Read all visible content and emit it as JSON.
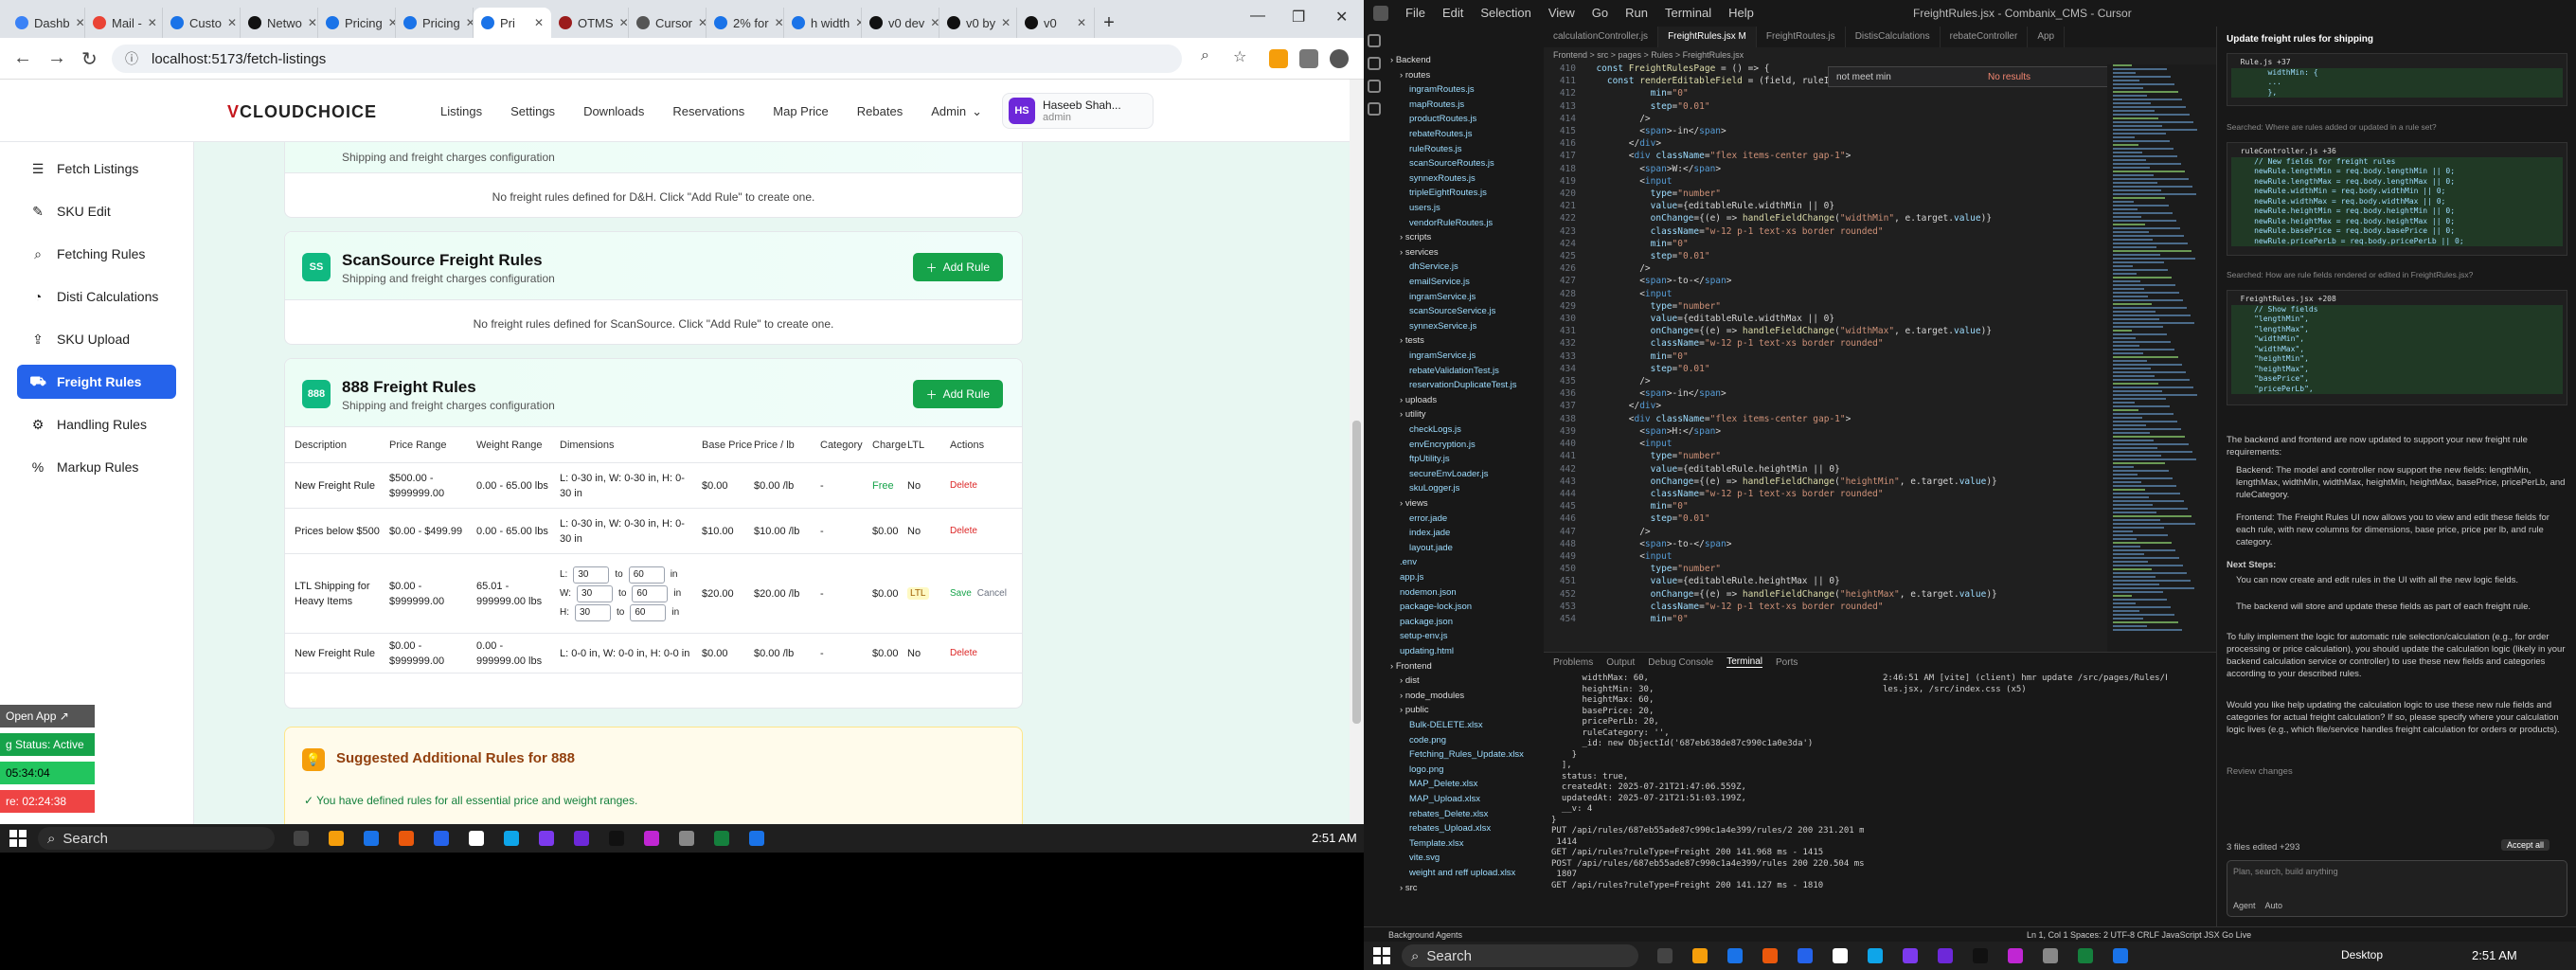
{
  "browser": {
    "tabs": [
      {
        "label": "Dashb",
        "color": "#3b82f6"
      },
      {
        "label": "Mail -",
        "color": "#ea4335"
      },
      {
        "label": "Custo",
        "color": "#1a73e8"
      },
      {
        "label": "Netwo",
        "color": "#111111"
      },
      {
        "label": "Pricing",
        "color": "#1a73e8"
      },
      {
        "label": "Pricing",
        "color": "#1a73e8"
      },
      {
        "label": "Pri",
        "color": "#1a73e8"
      },
      {
        "label": "OTMS",
        "color": "#9b1c1c"
      },
      {
        "label": "Cursor",
        "color": "#555555"
      },
      {
        "label": "2% for",
        "color": "#1a73e8"
      },
      {
        "label": "h width",
        "color": "#1a73e8"
      },
      {
        "label": "v0 dev",
        "color": "#111111"
      },
      {
        "label": "v0 by",
        "color": "#111111"
      },
      {
        "label": "v0",
        "color": "#111111"
      }
    ],
    "url": "localhost:5173/fetch-listings"
  },
  "app": {
    "logo_prefix": "V",
    "logo_rest": "CLOUDCHOICE",
    "nav": [
      "Listings",
      "Settings",
      "Downloads",
      "Reservations",
      "Map Price",
      "Rebates",
      "Admin"
    ],
    "admin_caret": "⌄",
    "user": {
      "initials": "HS",
      "name": "Haseeb Shah...",
      "role": "admin"
    },
    "sidebar": [
      {
        "label": "Fetch Listings",
        "icon": "☰"
      },
      {
        "label": "SKU Edit",
        "icon": "✎"
      },
      {
        "label": "Fetching Rules",
        "icon": "⌕"
      },
      {
        "label": "Disti Calculations",
        "icon": "◔"
      },
      {
        "label": "SKU Upload",
        "icon": "⇪"
      },
      {
        "label": "Freight Rules",
        "icon": "⛟"
      },
      {
        "label": "Handling Rules",
        "icon": "⚙"
      },
      {
        "label": "Markup Rules",
        "icon": "%"
      }
    ],
    "dh_top_sub": "Shipping and freight charges configuration",
    "dh_empty": "No freight rules defined for D&H. Click \"Add Rule\" to create one.",
    "scan": {
      "badge": "SS",
      "title": "ScanSource Freight Rules",
      "sub": "Shipping and freight charges configuration",
      "add": "Add Rule",
      "empty": "No freight rules defined for ScanSource. Click \"Add Rule\" to create one."
    },
    "r888": {
      "badge": "888",
      "title": "888 Freight Rules",
      "sub": "Shipping and freight charges configuration",
      "add": "Add Rule",
      "headers": [
        "Description",
        "Price Range",
        "Weight Range",
        "Dimensions",
        "Base Price",
        "Price / lb",
        "Category",
        "Charge",
        "LTL",
        "Actions"
      ],
      "rows": [
        {
          "desc": "New Freight Rule",
          "price": "$500.00 - $999999.00",
          "weight": "0.00 - 65.00 lbs",
          "dims": "L: 0-30 in, W: 0-30 in, H: 0-30 in",
          "base": "$0.00",
          "perlb": "$0.00 /lb",
          "cat": "-",
          "charge": "Free",
          "ltl": "No",
          "action": "Delete"
        },
        {
          "desc": "Prices below $500",
          "price": "$0.00 - $499.99",
          "weight": "0.00 - 65.00 lbs",
          "dims": "L: 0-30 in, W: 0-30 in, H: 0-30 in",
          "base": "$10.00",
          "perlb": "$10.00 /lb",
          "cat": "-",
          "charge": "$0.00",
          "ltl": "No",
          "action": "Delete"
        },
        {
          "desc": "LTL Shipping for Heavy Items",
          "price": "$0.00 - $999999.00",
          "weight": "65.01 - 999999.00 lbs",
          "dimL": "L:",
          "dimW": "W:",
          "dimH": "H:",
          "lmin": "30",
          "lmax": "60",
          "wmin": "30",
          "wmax": "60",
          "hmin": "30",
          "hmax": "60",
          "to": "to",
          "unit": "in",
          "base": "$20.00",
          "perlb": "$20.00 /lb",
          "cat": "-",
          "charge": "$0.00",
          "ltl": "LTL",
          "save": "Save",
          "cancel": "Cancel"
        },
        {
          "desc": "New Freight Rule",
          "price": "$0.00 - $999999.00",
          "weight": "0.00 - 999999.00 lbs",
          "dims": "L: 0-0 in, W: 0-0 in, H: 0-0 in",
          "base": "$0.00",
          "perlb": "$0.00 /lb",
          "cat": "-",
          "charge": "$0.00",
          "ltl": "No",
          "action": "Delete"
        }
      ]
    },
    "suggest": {
      "title": "Suggested Additional Rules for 888",
      "text": "✓ You have defined rules for all essential price and weight ranges."
    },
    "overlays": {
      "open_app": "Open App ↗",
      "status": "g Status: Active",
      "t1": "05:34:04",
      "t2": "re: 02:24:38"
    }
  },
  "taskbar": {
    "search": "Search",
    "time": "2:51 AM"
  },
  "vscode": {
    "menu": [
      "File",
      "Edit",
      "Selection",
      "View",
      "Go",
      "Run",
      "Terminal",
      "Help"
    ],
    "title": "FreightRules.jsx - Combanix_CMS - Cursor",
    "tabs": [
      "calculationController.js",
      "FreightRules.jsx M",
      "FreightRoutes.js",
      "DistisCalculations",
      "rebateController",
      "App"
    ],
    "crumb": "Frontend > src > pages > Rules > FreightRules.jsx",
    "find": "not meet min",
    "find_result": "No results",
    "explorer": [
      {
        "t": "Backend",
        "k": "folder",
        "d": 0
      },
      {
        "t": "routes",
        "k": "folder",
        "d": 1
      },
      {
        "t": "ingramRoutes.js",
        "k": "file",
        "d": 2
      },
      {
        "t": "mapRoutes.js",
        "k": "file",
        "d": 2
      },
      {
        "t": "productRoutes.js",
        "k": "file",
        "d": 2
      },
      {
        "t": "rebateRoutes.js",
        "k": "file",
        "d": 2
      },
      {
        "t": "ruleRoutes.js",
        "k": "file",
        "d": 2
      },
      {
        "t": "scanSourceRoutes.js",
        "k": "file",
        "d": 2
      },
      {
        "t": "synnexRoutes.js",
        "k": "file",
        "d": 2
      },
      {
        "t": "tripleEightRoutes.js",
        "k": "file",
        "d": 2
      },
      {
        "t": "users.js",
        "k": "file",
        "d": 2
      },
      {
        "t": "vendorRuleRoutes.js",
        "k": "file",
        "d": 2
      },
      {
        "t": "scripts",
        "k": "folder",
        "d": 1
      },
      {
        "t": "services",
        "k": "folder",
        "d": 1
      },
      {
        "t": "dhService.js",
        "k": "file",
        "d": 2
      },
      {
        "t": "emailService.js",
        "k": "file",
        "d": 2
      },
      {
        "t": "ingramService.js",
        "k": "file",
        "d": 2
      },
      {
        "t": "scanSourceService.js",
        "k": "file",
        "d": 2
      },
      {
        "t": "synnexService.js",
        "k": "file",
        "d": 2
      },
      {
        "t": "tests",
        "k": "folder",
        "d": 1
      },
      {
        "t": "ingramService.js",
        "k": "file",
        "d": 2
      },
      {
        "t": "rebateValidationTest.js",
        "k": "file",
        "d": 2
      },
      {
        "t": "reservationDuplicateTest.js",
        "k": "file",
        "d": 2
      },
      {
        "t": "uploads",
        "k": "folder",
        "d": 1
      },
      {
        "t": "utility",
        "k": "folder",
        "d": 1
      },
      {
        "t": "checkLogs.js",
        "k": "file",
        "d": 2
      },
      {
        "t": "envEncryption.js",
        "k": "file",
        "d": 2
      },
      {
        "t": "ftpUtility.js",
        "k": "file",
        "d": 2
      },
      {
        "t": "secureEnvLoader.js",
        "k": "file",
        "d": 2
      },
      {
        "t": "skuLogger.js",
        "k": "file",
        "d": 2
      },
      {
        "t": "views",
        "k": "folder",
        "d": 1
      },
      {
        "t": "error.jade",
        "k": "file",
        "d": 2
      },
      {
        "t": "index.jade",
        "k": "file",
        "d": 2
      },
      {
        "t": "layout.jade",
        "k": "file",
        "d": 2
      },
      {
        "t": ".env",
        "k": "file",
        "d": 1
      },
      {
        "t": "app.js",
        "k": "file",
        "d": 1
      },
      {
        "t": "nodemon.json",
        "k": "file",
        "d": 1
      },
      {
        "t": "package-lock.json",
        "k": "file",
        "d": 1
      },
      {
        "t": "package.json",
        "k": "file",
        "d": 1
      },
      {
        "t": "setup-env.js",
        "k": "file",
        "d": 1
      },
      {
        "t": "updating.html",
        "k": "file",
        "d": 1
      },
      {
        "t": "Frontend",
        "k": "folder",
        "d": 0
      },
      {
        "t": "dist",
        "k": "folder",
        "d": 1
      },
      {
        "t": "node_modules",
        "k": "folder",
        "d": 1
      },
      {
        "t": "public",
        "k": "folder",
        "d": 1
      },
      {
        "t": "Bulk-DELETE.xlsx",
        "k": "file",
        "d": 2
      },
      {
        "t": "code.png",
        "k": "file",
        "d": 2
      },
      {
        "t": "Fetching_Rules_Update.xlsx",
        "k": "file",
        "d": 2
      },
      {
        "t": "logo.png",
        "k": "file",
        "d": 2
      },
      {
        "t": "MAP_Delete.xlsx",
        "k": "file",
        "d": 2
      },
      {
        "t": "MAP_Upload.xlsx",
        "k": "file",
        "d": 2
      },
      {
        "t": "rebates_Delete.xlsx",
        "k": "file",
        "d": 2
      },
      {
        "t": "rebates_Upload.xlsx",
        "k": "file",
        "d": 2
      },
      {
        "t": "Template.xlsx",
        "k": "file",
        "d": 2
      },
      {
        "t": "vite.svg",
        "k": "file",
        "d": 2
      },
      {
        "t": "weight and reff upload.xlsx",
        "k": "file",
        "d": 2
      },
      {
        "t": "src",
        "k": "folder",
        "d": 1
      }
    ],
    "code_start": 410,
    "code": [
      "  const FreightRulesPage = () => {",
      "    const renderEditableField = (field, ruleItem, ruleSet) => {",
      "            min=\"0\"",
      "            step=\"0.01\"",
      "          />",
      "          <span>-in</span>",
      "        </div>",
      "        <div className=\"flex items-center gap-1\">",
      "          <span>W:</span>",
      "          <input",
      "            type=\"number\"",
      "            value={editableRule.widthMin || 0}",
      "            onChange={(e) => handleFieldChange(\"widthMin\", e.target.value)}",
      "            className=\"w-12 p-1 text-xs border rounded\"",
      "            min=\"0\"",
      "            step=\"0.01\"",
      "          />",
      "          <span>-to-</span>",
      "          <input",
      "            type=\"number\"",
      "            value={editableRule.widthMax || 0}",
      "            onChange={(e) => handleFieldChange(\"widthMax\", e.target.value)}",
      "            className=\"w-12 p-1 text-xs border rounded\"",
      "            min=\"0\"",
      "            step=\"0.01\"",
      "          />",
      "          <span>-in</span>",
      "        </div>",
      "        <div className=\"flex items-center gap-1\">",
      "          <span>H:</span>",
      "          <input",
      "            type=\"number\"",
      "            value={editableRule.heightMin || 0}",
      "            onChange={(e) => handleFieldChange(\"heightMin\", e.target.value)}",
      "            className=\"w-12 p-1 text-xs border rounded\"",
      "            min=\"0\"",
      "            step=\"0.01\"",
      "          />",
      "          <span>-to-</span>",
      "          <input",
      "            type=\"number\"",
      "            value={editableRule.heightMax || 0}",
      "            onChange={(e) => handleFieldChange(\"heightMax\", e.target.value)}",
      "            className=\"w-12 p-1 text-xs border rounded\"",
      "            min=\"0\""
    ],
    "panel_tabs": [
      "Problems",
      "Output",
      "Debug Console",
      "Terminal",
      "Ports"
    ],
    "terminal": [
      "      widthMax: 60,",
      "      heightMin: 30,",
      "      heightMax: 60,",
      "      basePrice: 20,",
      "      pricePerLb: 20,",
      "      ruleCategory: '',",
      "      _id: new ObjectId('687eb638de87c990c1a0e3da')",
      "    }",
      "  ],",
      "  status: true,",
      "  createdAt: 2025-07-21T21:47:06.559Z,",
      "  updatedAt: 2025-07-21T21:51:03.199Z,",
      "  __v: 4",
      "}",
      "PUT /api/rules/687eb55ade87c990c1a4e399/rules/2 200 231.201 ms -",
      " 1414",
      "GET /api/rules?ruleType=Freight 200 141.968 ms - 1415",
      "POST /api/rules/687eb55ade87c990c1a4e399/rules 200 220.504 ms -",
      " 1807",
      "GET /api/rules?ruleType=Freight 200 141.127 ms - 1810"
    ],
    "terminal2": [
      "2:46:51 AM [vite] (client) hmr update /src/pages/Rules/FreightRu",
      "les.jsx, /src/index.css (x5)"
    ],
    "chat": {
      "title": "Update freight rules for shipping",
      "code1": [
        "  Rule.js +37",
        "        widthMin: {",
        "        ...",
        "        },"
      ],
      "read1": "Searched: Where are rules added or updated in a rule set?",
      "code2": [
        "  ruleController.js +36",
        "     // New fields for freight rules",
        "     newRule.lengthMin = req.body.lengthMin || 0;",
        "     newRule.lengthMax = req.body.lengthMax || 0;",
        "     newRule.widthMin = req.body.widthMin || 0;",
        "     newRule.widthMax = req.body.widthMax || 0;",
        "     newRule.heightMin = req.body.heightMin || 0;",
        "     newRule.heightMax = req.body.heightMax || 0;",
        "     newRule.basePrice = req.body.basePrice || 0;",
        "     newRule.pricePerLb = req.body.pricePerLb || 0;"
      ],
      "read2": "Searched: How are rule fields rendered or edited in FreightRules.jsx?",
      "code3": [
        "  FreightRules.jsx +208",
        "     // Show fields",
        "     \"lengthMin\",",
        "     \"lengthMax\",",
        "     \"widthMin\",",
        "     \"widthMax\",",
        "     \"heightMin\",",
        "     \"heightMax\",",
        "     \"basePrice\",",
        "     \"pricePerLb\","
      ],
      "p1": "The backend and frontend are now updated to support your new freight rule requirements:",
      "b1": "Backend: The model and controller now support the new fields: lengthMin, lengthMax, widthMin, widthMax, heightMin, heightMax, basePrice, pricePerLb, and ruleCategory.",
      "b2": "Frontend: The Freight Rules UI now allows you to view and edit these fields for each rule, with new columns for dimensions, base price, price per lb, and rule category.",
      "next": "Next Steps:",
      "b3": "You can now create and edit rules in the UI with all the new logic fields.",
      "b4": "The backend will store and update these fields as part of each freight rule.",
      "p2": "To fully implement the logic for automatic rule selection/calculation (e.g., for order processing or price calculation), you should update the calculation logic (likely in your backend calculation service or controller) to use these new fields and categories according to your described rules.",
      "p3": "Would you like help updating the calculation logic to use these new rule fields and categories for actual freight calculation? If so, please specify where your calculation logic lives (e.g., which file/service handles freight calculation for orders or products).",
      "review": "Review changes",
      "files": "3 files edited +293",
      "accept": "Accept all",
      "input": "Plan, search, build anything",
      "agent": "Agent",
      "auto": "Auto"
    },
    "status": {
      "left": "Background Agents",
      "ln": "Ln 1, Col 1   Spaces: 2   UTF-8   CRLF   JavaScript JSX   Go Live"
    }
  },
  "rtaskbar": {
    "search": "Search",
    "desktop": "Desktop",
    "time": "2:51 AM"
  }
}
